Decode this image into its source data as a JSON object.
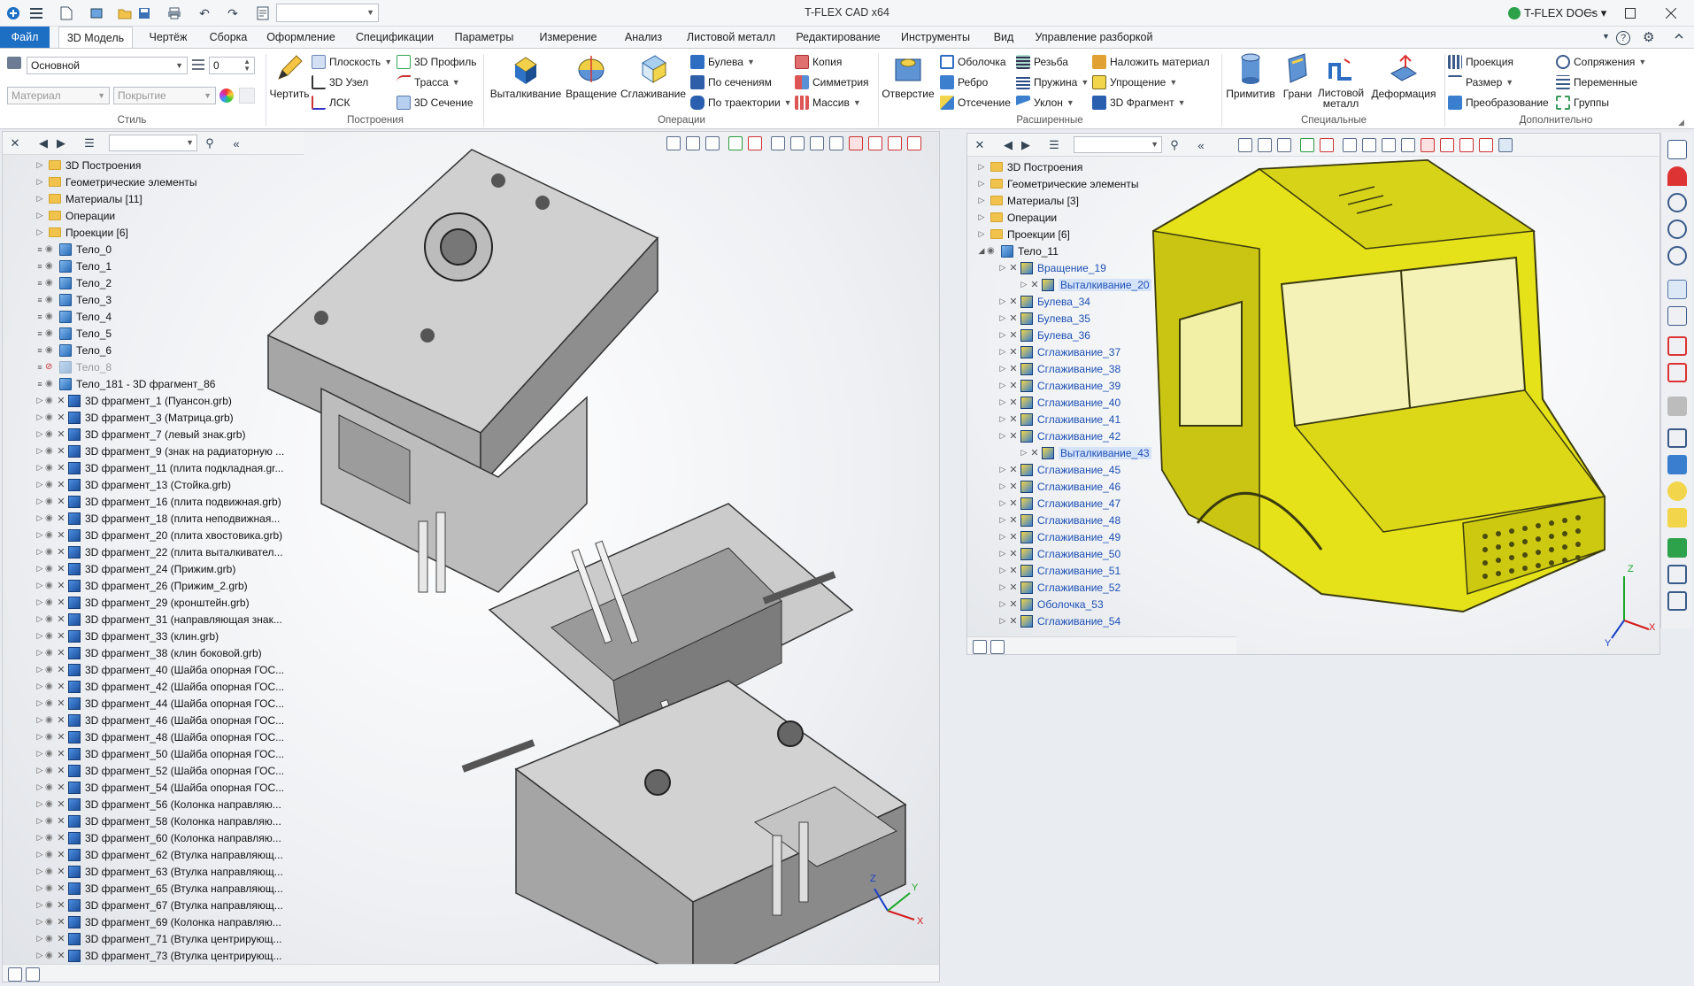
{
  "titlebar": {
    "app_title": "T-FLEX CAD x64",
    "docs_label": "T-FLEX DOCs",
    "docs_caret": "▾",
    "help_icon": "?"
  },
  "tabs": [
    {
      "label": "Файл"
    },
    {
      "label": "3D Модель"
    },
    {
      "label": "Чертёж"
    },
    {
      "label": "Сборка"
    },
    {
      "label": "Оформление"
    },
    {
      "label": "Спецификации"
    },
    {
      "label": "Параметры"
    },
    {
      "label": "Измерение"
    },
    {
      "label": "Анализ"
    },
    {
      "label": "Листовой металл"
    },
    {
      "label": "Редактирование"
    },
    {
      "label": "Инструменты"
    },
    {
      "label": "Вид"
    },
    {
      "label": "Управление разборкой"
    }
  ],
  "ribbon": {
    "style": {
      "layer_value": "Основной",
      "num_value": "0",
      "material_placeholder": "Материал",
      "coating_placeholder": "Покрытие",
      "group_label": "Стиль"
    },
    "build": {
      "draw": "Чертить",
      "plane": "Плоскость",
      "node3d": "3D Узел",
      "lsk": "ЛСК",
      "profile3d": "3D Профиль",
      "route": "Трасса",
      "section3d": "3D Сечение",
      "group_label": "Построения"
    },
    "ops": {
      "extrude": "Выталкивание",
      "revolve": "Вращение",
      "smooth": "Сглаживание",
      "boolean": "Булева",
      "bysections": "По сечениям",
      "bytrajectory": "По траектории",
      "copy": "Копия",
      "symmetry": "Симметрия",
      "array": "Массив",
      "group_label": "Операции"
    },
    "ext": {
      "hole": "Отверстие",
      "shell": "Оболочка",
      "rib": "Ребро",
      "cutoff": "Отсечение",
      "thread": "Резьба",
      "spring": "Пружина",
      "slope": "Уклон",
      "apply_material": "Наложить материал",
      "simplify": "Упрощение",
      "fragment3d": "3D Фрагмент",
      "group_label": "Расширенные"
    },
    "special": {
      "primitives": "Примитив",
      "faces": "Грани",
      "sheet_metal_1": "Листовой",
      "sheet_metal_2": "металл",
      "deformation": "Деформация",
      "group_label": "Специальные"
    },
    "extra": {
      "projection": "Проекция",
      "size": "Размер",
      "transform": "Преобразование",
      "mates": "Сопряжения",
      "variables": "Переменные",
      "groups": "Группы",
      "group_label": "Дополнительно"
    }
  },
  "left_tree": [
    {
      "label": "3D Построения",
      "kind": "folder"
    },
    {
      "label": "Геометрические элементы",
      "kind": "folder"
    },
    {
      "label": "Материалы [11]",
      "kind": "folder"
    },
    {
      "label": "Операции",
      "kind": "folder"
    },
    {
      "label": "Проекции [6]",
      "kind": "folder"
    },
    {
      "label": "Тело_0",
      "kind": "body"
    },
    {
      "label": "Тело_1",
      "kind": "body"
    },
    {
      "label": "Тело_2",
      "kind": "body"
    },
    {
      "label": "Тело_3",
      "kind": "body"
    },
    {
      "label": "Тело_4",
      "kind": "body"
    },
    {
      "label": "Тело_5",
      "kind": "body"
    },
    {
      "label": "Тело_6",
      "kind": "body"
    },
    {
      "label": "Тело_8",
      "kind": "body-hidden"
    },
    {
      "label": "Тело_181 - 3D фрагмент_86",
      "kind": "body"
    },
    {
      "label": "3D фрагмент_1 (Пуансон.grb)",
      "kind": "frag"
    },
    {
      "label": "3D фрагмент_3 (Матрица.grb)",
      "kind": "frag"
    },
    {
      "label": "3D фрагмент_7 (левый знак.grb)",
      "kind": "frag"
    },
    {
      "label": "3D фрагмент_9 (знак на радиаторную ...",
      "kind": "frag"
    },
    {
      "label": "3D фрагмент_11 (плита подкладная.gr...",
      "kind": "frag"
    },
    {
      "label": "3D фрагмент_13 (Стойка.grb)",
      "kind": "frag"
    },
    {
      "label": "3D фрагмент_16 (плита подвижная.grb)",
      "kind": "frag"
    },
    {
      "label": "3D фрагмент_18 (плита неподвижная...",
      "kind": "frag"
    },
    {
      "label": "3D фрагмент_20 (плита хвостовика.grb)",
      "kind": "frag"
    },
    {
      "label": "3D фрагмент_22 (плита выталкивател...",
      "kind": "frag"
    },
    {
      "label": "3D фрагмент_24 (Прижим.grb)",
      "kind": "frag"
    },
    {
      "label": "3D фрагмент_26 (Прижим_2.grb)",
      "kind": "frag"
    },
    {
      "label": "3D фрагмент_29 (кронштейн.grb)",
      "kind": "frag"
    },
    {
      "label": "3D фрагмент_31 (направляющая знак...",
      "kind": "frag"
    },
    {
      "label": "3D фрагмент_33 (клин.grb)",
      "kind": "frag"
    },
    {
      "label": "3D фрагмент_38 (клин боковой.grb)",
      "kind": "frag"
    },
    {
      "label": "3D фрагмент_40 (Шайба опорная ГОС...",
      "kind": "frag"
    },
    {
      "label": "3D фрагмент_42 (Шайба опорная ГОС...",
      "kind": "frag"
    },
    {
      "label": "3D фрагмент_44 (Шайба опорная ГОС...",
      "kind": "frag"
    },
    {
      "label": "3D фрагмент_46 (Шайба опорная ГОС...",
      "kind": "frag"
    },
    {
      "label": "3D фрагмент_48 (Шайба опорная ГОС...",
      "kind": "frag"
    },
    {
      "label": "3D фрагмент_50 (Шайба опорная ГОС...",
      "kind": "frag"
    },
    {
      "label": "3D фрагмент_52 (Шайба опорная ГОС...",
      "kind": "frag"
    },
    {
      "label": "3D фрагмент_54 (Шайба опорная ГОС...",
      "kind": "frag"
    },
    {
      "label": "3D фрагмент_56 (Колонка направляю...",
      "kind": "frag"
    },
    {
      "label": "3D фрагмент_58 (Колонка направляю...",
      "kind": "frag"
    },
    {
      "label": "3D фрагмент_60 (Колонка направляю...",
      "kind": "frag"
    },
    {
      "label": "3D фрагмент_62 (Втулка направляющ...",
      "kind": "frag"
    },
    {
      "label": "3D фрагмент_63 (Втулка направляющ...",
      "kind": "frag"
    },
    {
      "label": "3D фрагмент_65 (Втулка направляющ...",
      "kind": "frag"
    },
    {
      "label": "3D фрагмент_67 (Втулка направляющ...",
      "kind": "frag"
    },
    {
      "label": "3D фрагмент_69 (Колонка направляю...",
      "kind": "frag"
    },
    {
      "label": "3D фрагмент_71 (Втулка центрирующ...",
      "kind": "frag"
    },
    {
      "label": "3D фрагмент_73 (Втулка центрирующ...",
      "kind": "frag"
    }
  ],
  "right_tree": [
    {
      "label": "3D Построения",
      "kind": "folder",
      "indent": 0
    },
    {
      "label": "Геометрические элементы",
      "kind": "folder",
      "indent": 0
    },
    {
      "label": "Материалы [3]",
      "kind": "folder",
      "indent": 0
    },
    {
      "label": "Операции",
      "kind": "folder",
      "indent": 0
    },
    {
      "label": "Проекции [6]",
      "kind": "folder",
      "indent": 0
    },
    {
      "label": "Тело_11",
      "kind": "body",
      "indent": 0
    },
    {
      "label": "Вращение_19",
      "kind": "op",
      "indent": 1
    },
    {
      "label": "Выталкивание_20",
      "kind": "op-sel",
      "indent": 2
    },
    {
      "label": "Булева_34",
      "kind": "op",
      "indent": 1
    },
    {
      "label": "Булева_35",
      "kind": "op",
      "indent": 1
    },
    {
      "label": "Булева_36",
      "kind": "op",
      "indent": 1
    },
    {
      "label": "Сглаживание_37",
      "kind": "op",
      "indent": 1
    },
    {
      "label": "Сглаживание_38",
      "kind": "op",
      "indent": 1
    },
    {
      "label": "Сглаживание_39",
      "kind": "op",
      "indent": 1
    },
    {
      "label": "Сглаживание_40",
      "kind": "op",
      "indent": 1
    },
    {
      "label": "Сглаживание_41",
      "kind": "op",
      "indent": 1
    },
    {
      "label": "Сглаживание_42",
      "kind": "op",
      "indent": 1
    },
    {
      "label": "Выталкивание_43",
      "kind": "op-sel",
      "indent": 2
    },
    {
      "label": "Сглаживание_45",
      "kind": "op",
      "indent": 1
    },
    {
      "label": "Сглаживание_46",
      "kind": "op",
      "indent": 1
    },
    {
      "label": "Сглаживание_47",
      "kind": "op",
      "indent": 1
    },
    {
      "label": "Сглаживание_48",
      "kind": "op",
      "indent": 1
    },
    {
      "label": "Сглаживание_49",
      "kind": "op",
      "indent": 1
    },
    {
      "label": "Сглаживание_50",
      "kind": "op",
      "indent": 1
    },
    {
      "label": "Сглаживание_51",
      "kind": "op",
      "indent": 1
    },
    {
      "label": "Сглаживание_52",
      "kind": "op",
      "indent": 1
    },
    {
      "label": "Оболочка_53",
      "kind": "op",
      "indent": 1
    },
    {
      "label": "Сглаживание_54",
      "kind": "op",
      "indent": 1
    }
  ],
  "axis": {
    "x": "X",
    "y": "Y",
    "z": "Z"
  },
  "icons": {
    "close": "✕",
    "back": "◀",
    "forward": "▶",
    "list": "☰",
    "search": "⚲",
    "collapse": "«",
    "undo": "↶",
    "redo": "↷",
    "save": "💾",
    "print": "🖶",
    "gear": "⚙"
  },
  "colors": {
    "accent": "#1d6fc4",
    "body_yellow": "#e6e21a",
    "mold_grey": "#b9b9b9",
    "link_blue": "#1c4fb4",
    "folder": "#f1c24c"
  }
}
